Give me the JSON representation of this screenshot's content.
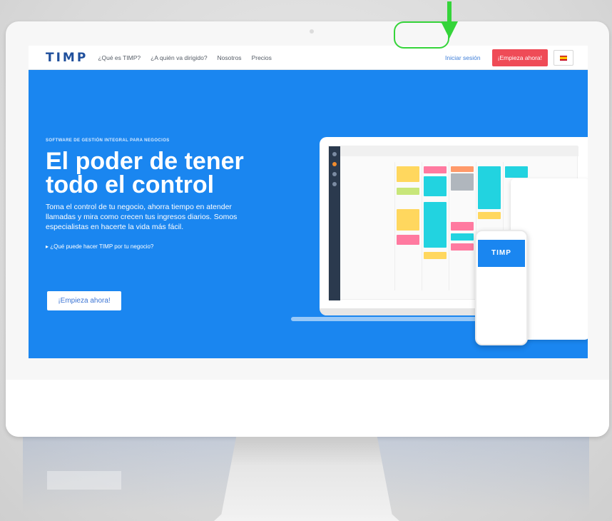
{
  "nav": {
    "logo": "TIMP",
    "links": [
      "¿Qué es TIMP?",
      "¿A quién va dirigido?",
      "Nosotros",
      "Precios"
    ],
    "login_label": "Iniciar sesión",
    "cta_label": "¡Empieza ahora!",
    "language": "es"
  },
  "hero": {
    "kicker": "SOFTWARE DE GESTIÓN INTEGRAL PARA NEGOCIOS",
    "headline": "El poder de tener todo el control",
    "description": "Toma el control de tu negocio, ahorra tiempo en atender llamadas y mira como crecen tus ingresos diarios. Somos especialistas en hacerte la vida más fácil.",
    "question": "¿Qué puede hacer TIMP por tu negocio?",
    "cta_label": "¡Empieza ahora!"
  },
  "mockup": {
    "phone_logo": "TIMP"
  },
  "colors": {
    "hero_blue": "#1a86f0",
    "cta_red": "#ef4b57",
    "highlight_green": "#35d43a"
  }
}
